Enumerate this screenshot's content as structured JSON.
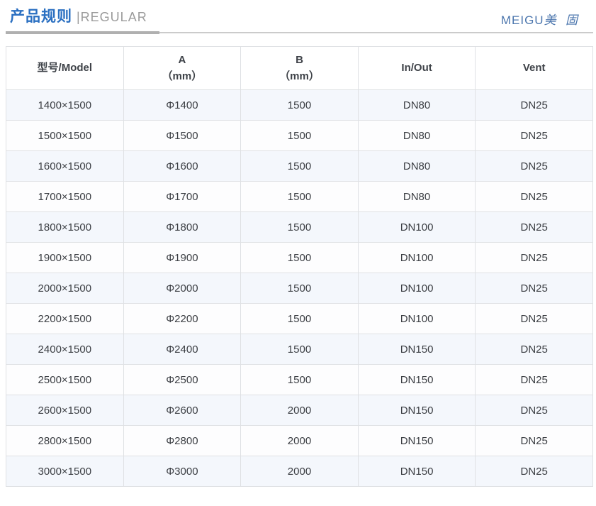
{
  "header": {
    "title_cn": "产品规则",
    "title_en": "|REGULAR",
    "logo_latin": "MEIGU",
    "logo_cn": "美 固"
  },
  "colors": {
    "title_blue": "#2a6fc1",
    "title_en_gray": "#9b9b9b",
    "logo_blue": "#4d77ae",
    "rule_dark": "#b0b0b0",
    "rule_light": "#cbcbcb",
    "table_border": "#dfe1e4",
    "row_odd_bg": "#f4f7fc",
    "row_even_bg": "#fdfdfe",
    "text_dark": "#3a3d42"
  },
  "table": {
    "columns": [
      {
        "key": "model",
        "line1": "型号/Model",
        "line2": ""
      },
      {
        "key": "a-mm",
        "line1": "A",
        "line2": "（mm）"
      },
      {
        "key": "b-mm",
        "line1": "B",
        "line2": "（mm）"
      },
      {
        "key": "in-out",
        "line1": "In/Out",
        "line2": ""
      },
      {
        "key": "vent",
        "line1": "Vent",
        "line2": ""
      }
    ],
    "rows": [
      [
        "1400×1500",
        "Φ1400",
        "1500",
        "DN80",
        "DN25"
      ],
      [
        "1500×1500",
        "Φ1500",
        "1500",
        "DN80",
        "DN25"
      ],
      [
        "1600×1500",
        "Φ1600",
        "1500",
        "DN80",
        "DN25"
      ],
      [
        "1700×1500",
        "Φ1700",
        "1500",
        "DN80",
        "DN25"
      ],
      [
        "1800×1500",
        "Φ1800",
        "1500",
        "DN100",
        "DN25"
      ],
      [
        "1900×1500",
        "Φ1900",
        "1500",
        "DN100",
        "DN25"
      ],
      [
        "2000×1500",
        "Φ2000",
        "1500",
        "DN100",
        "DN25"
      ],
      [
        "2200×1500",
        "Φ2200",
        "1500",
        "DN100",
        "DN25"
      ],
      [
        "2400×1500",
        "Φ2400",
        "1500",
        "DN150",
        "DN25"
      ],
      [
        "2500×1500",
        "Φ2500",
        "1500",
        "DN150",
        "DN25"
      ],
      [
        "2600×1500",
        "Φ2600",
        "2000",
        "DN150",
        "DN25"
      ],
      [
        "2800×1500",
        "Φ2800",
        "2000",
        "DN150",
        "DN25"
      ],
      [
        "3000×1500",
        "Φ3000",
        "2000",
        "DN150",
        "DN25"
      ]
    ]
  }
}
